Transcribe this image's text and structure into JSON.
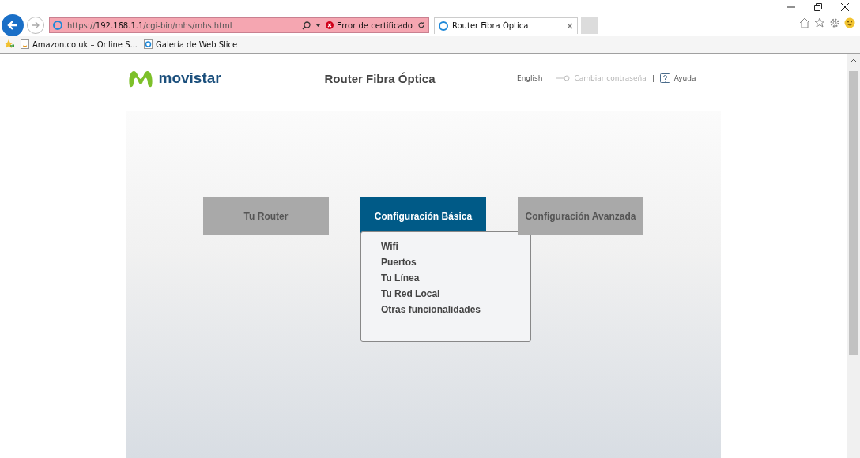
{
  "browser": {
    "url": {
      "scheme": "https://",
      "host": "192.168.1.1",
      "path": "/cgi-bin/mhs/mhs.html"
    },
    "cert_error": "Error de certificado",
    "tabs": [
      {
        "title": "Router Fibra Óptica",
        "selected": true
      }
    ],
    "favorites": [
      "Amazon.co.uk – Online S...",
      "Galería de Web Slice"
    ]
  },
  "header": {
    "logo": "movistar",
    "title": "Router Fibra Óptica",
    "links": [
      {
        "kind": "language",
        "label": "English",
        "disabled": false
      },
      {
        "kind": "password",
        "label": "Cambiar contraseña",
        "disabled": true
      },
      {
        "kind": "help",
        "label": "Ayuda",
        "disabled": false
      }
    ]
  },
  "nav": [
    {
      "label": "Tu Router",
      "selected": false
    },
    {
      "label": "Configuración Básica",
      "selected": true,
      "menu": [
        "Wifi",
        "Puertos",
        "Tu Línea",
        "Tu Red Local",
        "Otras funcionalidades"
      ]
    },
    {
      "label": "Configuración Avanzada",
      "selected": false
    }
  ]
}
